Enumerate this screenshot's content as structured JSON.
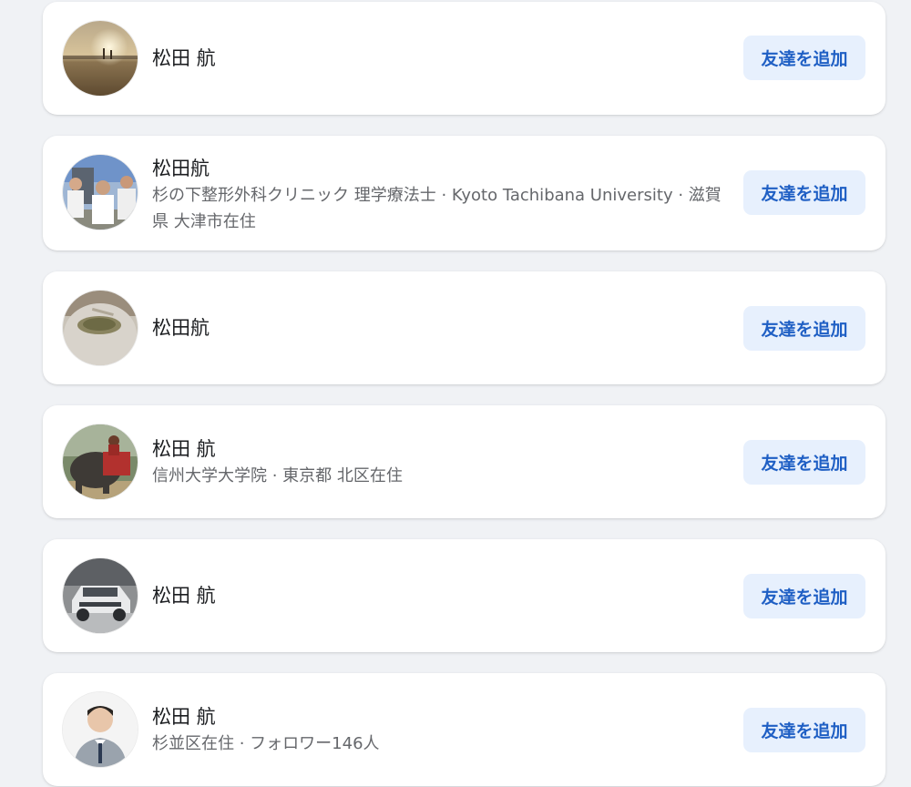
{
  "people": [
    {
      "name": "松田 航",
      "subtitle": "",
      "button_label": "友達を追加",
      "avatar": "sunset-field-photo"
    },
    {
      "name": "松田航",
      "subtitle": "杉の下整形外科クリニック 理学療法士 · Kyoto Tachibana University · 滋賀県 大津市在住",
      "button_label": "友達を追加",
      "avatar": "group-photo"
    },
    {
      "name": "松田航",
      "subtitle": "",
      "button_label": "友達を追加",
      "avatar": "stone-basin-photo"
    },
    {
      "name": "松田 航",
      "subtitle": "信州大学大学院 · 東京都 北区在住",
      "button_label": "友達を追加",
      "avatar": "elephant-photo"
    },
    {
      "name": "松田 航",
      "subtitle": "",
      "button_label": "友達を追加",
      "avatar": "car-photo"
    },
    {
      "name": "松田 航",
      "subtitle": "杉並区在住 · フォロワー146人",
      "button_label": "友達を追加",
      "avatar": "portrait-photo"
    }
  ],
  "colors": {
    "background": "#f0f2f5",
    "card": "#ffffff",
    "button_bg": "#e7f0fd",
    "button_text": "#1f5fc4"
  }
}
